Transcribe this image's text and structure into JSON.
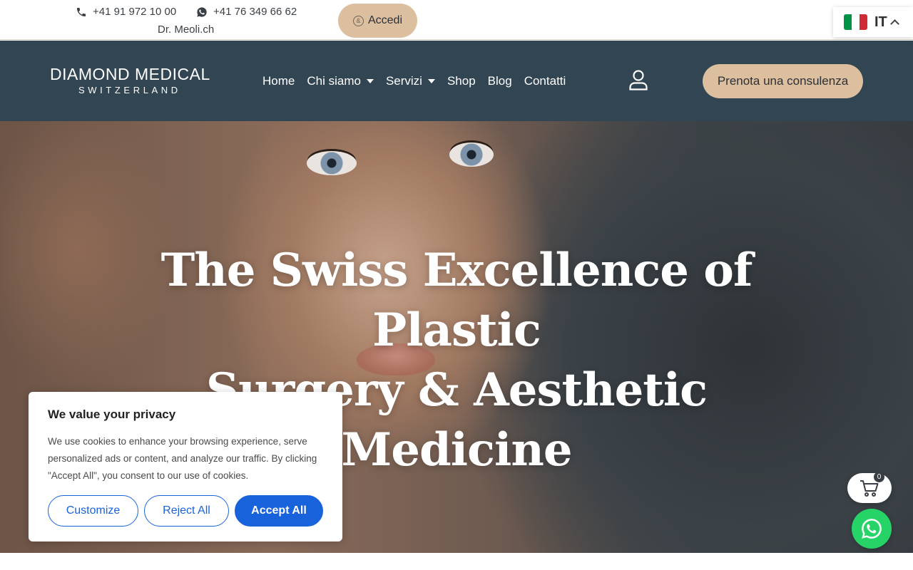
{
  "topbar": {
    "phone": "+41 91 972 10 00",
    "whatsapp": "+41 76 349 66 62",
    "subtitle": "Dr. Meoli.ch",
    "login_label": "Accedi",
    "language": {
      "code": "IT",
      "flag_colors": [
        "#009246",
        "#ffffff",
        "#ce2b37"
      ]
    }
  },
  "nav": {
    "logo_main": "DIAMOND MEDICAL",
    "logo_sub": "SWITZERLAND",
    "items": [
      {
        "label": "Home",
        "has_dropdown": false
      },
      {
        "label": "Chi siamo",
        "has_dropdown": true
      },
      {
        "label": "Servizi",
        "has_dropdown": true
      },
      {
        "label": "Shop",
        "has_dropdown": false
      },
      {
        "label": "Blog",
        "has_dropdown": false
      },
      {
        "label": "Contatti",
        "has_dropdown": false
      }
    ],
    "account_icon": "user-icon",
    "cta_label": "Prenota una consulenza"
  },
  "hero": {
    "title_line1": "The Swiss Excellence of Plastic",
    "title_line2": "Surgery & Aesthetic Medicine"
  },
  "cookie": {
    "title": "We value your privacy",
    "text": "We use cookies to enhance your browsing experience, serve personalized ads or content, and analyze our traffic. By clicking \"Accept All\", you consent to our use of cookies.",
    "customize_label": "Customize",
    "reject_label": "Reject All",
    "accept_label": "Accept All"
  },
  "widgets": {
    "cart_count": "0",
    "cart_icon": "cart-icon",
    "whatsapp_icon": "whatsapp-icon"
  },
  "colors": {
    "nav_bg": "#324552",
    "accent_beige": "#dcbf9f",
    "cookie_blue": "#1863dc",
    "whatsapp_green": "#25d366"
  }
}
